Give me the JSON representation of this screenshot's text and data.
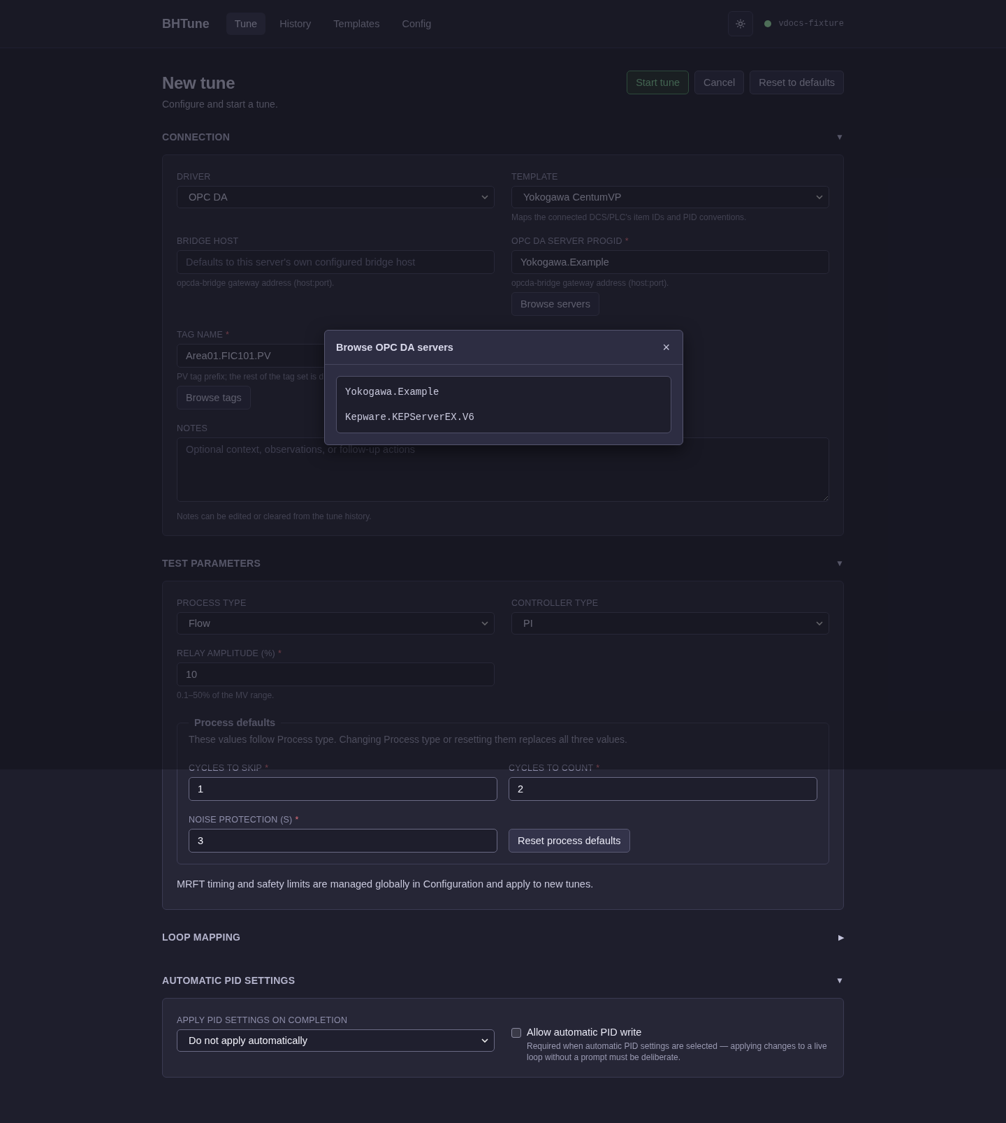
{
  "header": {
    "brand": "BHTune",
    "tabs": [
      {
        "label": "Tune",
        "selected": true
      },
      {
        "label": "History",
        "selected": false
      },
      {
        "label": "Templates",
        "selected": false
      },
      {
        "label": "Config",
        "selected": false
      }
    ],
    "connection_status": {
      "label": "vdocs-fixture",
      "color": "#4e6e58"
    }
  },
  "page": {
    "title": "New tune",
    "subtitle": "Configure and start a tune.",
    "actions": [
      {
        "label": "Start tune",
        "kind": "primary"
      },
      {
        "label": "Cancel",
        "kind": "default"
      },
      {
        "label": "Reset to defaults",
        "kind": "default"
      }
    ]
  },
  "connection": {
    "title": "CONNECTION",
    "toggle": "▼",
    "expanded": true,
    "driver": {
      "label": "DRIVER",
      "value": "OPC DA"
    },
    "template": {
      "label": "TEMPLATE",
      "value": "Yokogawa CentumVP",
      "hint": "Maps the connected DCS/PLC's item IDs and PID conventions."
    },
    "bridge_host": {
      "label": "BRIDGE HOST",
      "placeholder": "Defaults to this server's own configured bridge host",
      "hint": "opcda-bridge gateway address (host:port)."
    },
    "server_progid": {
      "label": "OPC DA SERVER PROGID",
      "required_mark": "*",
      "value": "Yokogawa.Example",
      "hint": "opcda-bridge gateway address (host:port).",
      "button": "Browse servers"
    },
    "tag_name": {
      "label": "TAG NAME",
      "required_mark": "*",
      "value": "Area01.FIC101.PV",
      "hint": "PV tag prefix; the rest of the tag set is d",
      "button": "Browse tags"
    },
    "notes": {
      "label": "NOTES",
      "placeholder": "Optional context, observations, or follow-up actions",
      "hint": "Notes can be edited or cleared from the tune history."
    }
  },
  "test_parameters": {
    "title": "TEST PARAMETERS",
    "toggle": "▼",
    "expanded": true,
    "process_type": {
      "label": "PROCESS TYPE",
      "value": "Flow"
    },
    "controller_type": {
      "label": "CONTROLLER TYPE",
      "value": "PI"
    },
    "relay_amplitude": {
      "label": "RELAY AMPLITUDE (%)",
      "required_mark": "*",
      "value": "10",
      "hint": "0.1–50% of the MV range."
    },
    "process_defaults": {
      "legend": "Process defaults",
      "description": "These values follow Process type. Changing Process type or resetting them replaces all three values.",
      "cycles_to_skip": {
        "label": "CYCLES TO SKIP",
        "required_mark": "*",
        "value": "1"
      },
      "cycles_to_count": {
        "label": "CYCLES TO COUNT",
        "required_mark": "*",
        "value": "2"
      },
      "noise_protection": {
        "label": "NOISE PROTECTION (S)",
        "required_mark": "*",
        "value": "3"
      },
      "reset_button": "Reset process defaults"
    },
    "footnote": "MRFT timing and safety limits are managed globally in Configuration and apply to new tunes."
  },
  "loop_mapping": {
    "title": "LOOP MAPPING",
    "toggle": "▶",
    "expanded": false
  },
  "automatic_pid": {
    "title": "AUTOMATIC PID SETTINGS",
    "toggle": "▼",
    "expanded": true,
    "apply": {
      "label": "APPLY PID SETTINGS ON COMPLETION",
      "value": "Do not apply automatically"
    },
    "allow_write": {
      "label": "Allow automatic PID write",
      "checked": false,
      "hint": "Required when automatic PID settings are selected — applying changes to a live loop without a prompt must be deliberate."
    }
  },
  "modal": {
    "title": "Browse OPC DA servers",
    "close": "×",
    "items": [
      "Yokogawa.Example",
      "Kepware.KEPServerEX.V6"
    ]
  }
}
